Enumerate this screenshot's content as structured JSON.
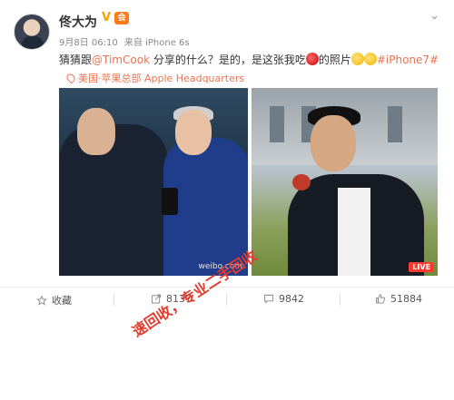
{
  "post": {
    "username": "佟大为",
    "verified_badge": "V",
    "vip_badge": "会",
    "timestamp": "9月8日 06:10",
    "source": "来自 iPhone 6s",
    "text_parts": {
      "prefix": "猜猜跟",
      "mention": "@TimCook",
      "middle": " 分享的什么？是的，是这张我吃",
      "after_apple": "的照片",
      "hashtag": "#iPhone7#"
    },
    "location": "美国·苹果总部 Apple Headquarters",
    "photo_left_watermark": "weibo.com",
    "photo_right_badge": "LIVE"
  },
  "actions": {
    "favorite_label": "收藏",
    "forward_count": "8137",
    "comment_count": "9842",
    "like_count": "51884"
  },
  "overlay": {
    "watermark_text": "速回收，专业二手回收"
  },
  "colors": {
    "link": "#eb7350",
    "watermark": "#e33b2e"
  },
  "icons": [
    "chevron-down-icon",
    "location-pin-icon",
    "star-icon",
    "forward-icon",
    "comment-icon",
    "like-icon"
  ]
}
